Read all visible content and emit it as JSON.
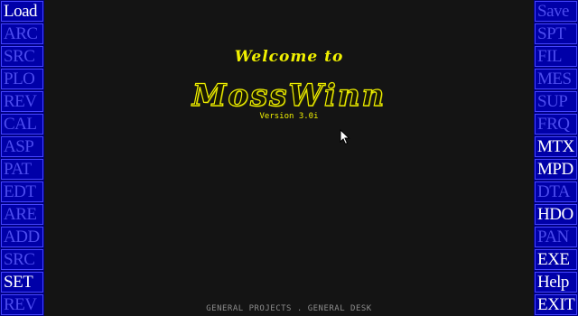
{
  "left_menu": [
    {
      "label": "Load",
      "enabled": true
    },
    {
      "label": "ARC",
      "enabled": false
    },
    {
      "label": "SRC",
      "enabled": false
    },
    {
      "label": "PLO",
      "enabled": false
    },
    {
      "label": "REV",
      "enabled": false
    },
    {
      "label": "CAL",
      "enabled": false
    },
    {
      "label": "ASP",
      "enabled": false
    },
    {
      "label": "PAT",
      "enabled": false
    },
    {
      "label": "EDT",
      "enabled": false
    },
    {
      "label": "ARE",
      "enabled": false
    },
    {
      "label": "ADD",
      "enabled": false
    },
    {
      "label": "SRC",
      "enabled": false
    },
    {
      "label": "SET",
      "enabled": true
    },
    {
      "label": "REV",
      "enabled": false
    }
  ],
  "right_menu": [
    {
      "label": "Save",
      "enabled": false
    },
    {
      "label": "SPT",
      "enabled": false
    },
    {
      "label": "FIL",
      "enabled": false
    },
    {
      "label": "MES",
      "enabled": false
    },
    {
      "label": "SUP",
      "enabled": false
    },
    {
      "label": "FRQ",
      "enabled": false
    },
    {
      "label": "MTX",
      "enabled": true
    },
    {
      "label": "MPD",
      "enabled": true
    },
    {
      "label": "DTA",
      "enabled": false
    },
    {
      "label": "HDO",
      "enabled": true
    },
    {
      "label": "PAN",
      "enabled": false
    },
    {
      "label": "EXE",
      "enabled": true
    },
    {
      "label": "Help",
      "enabled": true
    },
    {
      "label": "EXIT",
      "enabled": true
    }
  ],
  "splash": {
    "welcome": "Welcome to",
    "product": "MossWinn",
    "version": "Version 3.0i"
  },
  "footer": "GENERAL PROJECTS . GENERAL DESK",
  "colors": {
    "background": "#141414",
    "sidebar": "#000080",
    "button": "#0000a8",
    "button_enabled_text": "#ffffff",
    "button_disabled_text": "#4c4cee",
    "title_yellow": "#f0f000",
    "footer_gray": "#8c8c8c"
  },
  "icons": {
    "cursor": "mouse-pointer-icon"
  }
}
